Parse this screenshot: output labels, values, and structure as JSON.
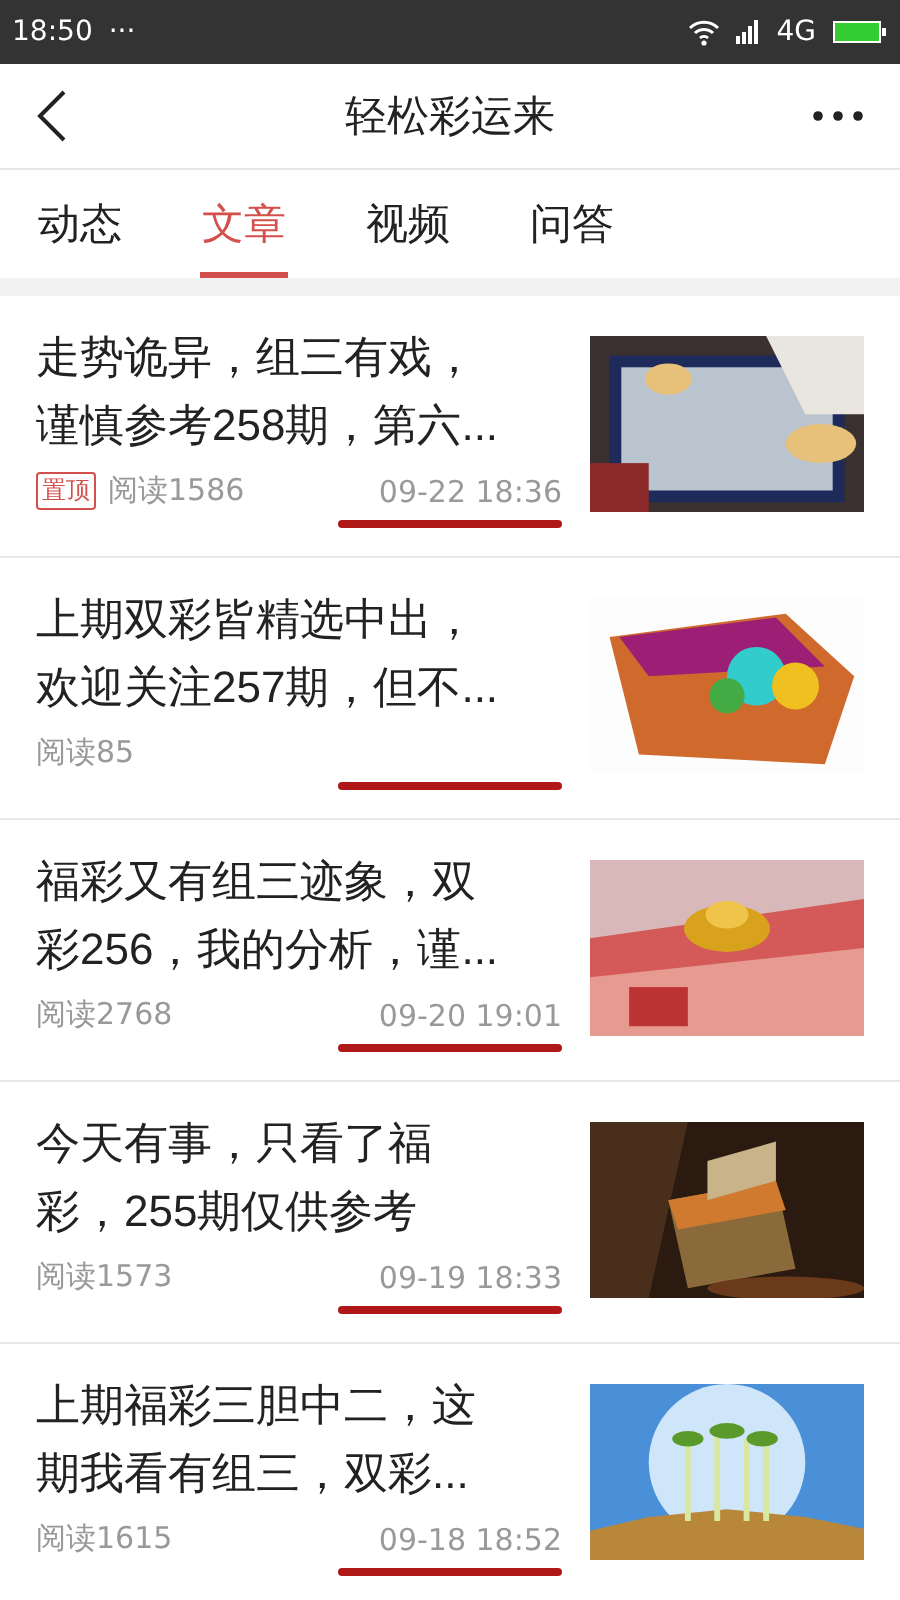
{
  "status_bar": {
    "time": "18:50",
    "dots": "···",
    "network": "4G"
  },
  "header": {
    "title": "轻松彩运来"
  },
  "tabs": [
    {
      "label": "动态",
      "selected": false
    },
    {
      "label": "文章",
      "selected": true
    },
    {
      "label": "视频",
      "selected": false
    },
    {
      "label": "问答",
      "selected": false
    }
  ],
  "articles": [
    {
      "title": "走势诡异，组三有戏，谨慎参考258期，第六...",
      "pinned_label": "置顶",
      "reads": "阅读1586",
      "date": "09-22 18:36",
      "underlined": true
    },
    {
      "title": "上期双彩皆精选中出，欢迎关注257期，但不...",
      "reads": "阅读85",
      "underlined": true
    },
    {
      "title": "福彩又有组三迹象，双彩256，我的分析，谨...",
      "reads": "阅读2768",
      "date": "09-20 19:01",
      "underlined": true
    },
    {
      "title": "今天有事，只看了福彩，255期仅供参考",
      "reads": "阅读1573",
      "date": "09-19 18:33",
      "underlined": true
    },
    {
      "title": "上期福彩三胆中二，这期我看有组三，双彩...",
      "reads": "阅读1615",
      "date": "09-18 18:52",
      "underlined": true
    }
  ]
}
